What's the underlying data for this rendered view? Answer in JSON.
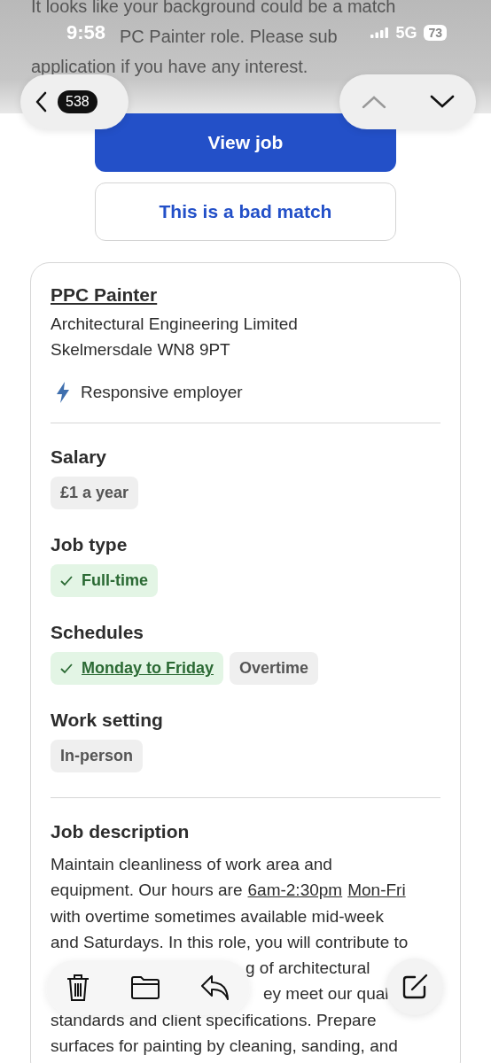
{
  "intro_lines": [
    "It looks like your background could be a match",
    "PC Painter role. Please sub",
    "application if you have any interest."
  ],
  "status_bar": {
    "time": "9:58",
    "network": "5G",
    "battery": "73"
  },
  "nav": {
    "count": "538"
  },
  "buttons": {
    "primary": "View job",
    "secondary": "This is a bad match"
  },
  "job": {
    "title": "PPC Painter",
    "company": "Architectural Engineering Limited",
    "location": "Skelmersdale WN8 9PT",
    "badge": "Responsive employer"
  },
  "sections": [
    {
      "heading": "Salary",
      "tags": [
        {
          "label": "£1 a year",
          "matched": false,
          "link": false
        }
      ]
    },
    {
      "heading": "Job type",
      "tags": [
        {
          "label": "Full-time",
          "matched": true,
          "link": false
        }
      ]
    },
    {
      "heading": "Schedules",
      "tags": [
        {
          "label": "Monday to Friday",
          "matched": true,
          "link": true
        },
        {
          "label": "Overtime",
          "matched": false,
          "link": false
        }
      ]
    },
    {
      "heading": "Work setting",
      "tags": [
        {
          "label": "In-person",
          "matched": false,
          "link": false
        }
      ]
    }
  ],
  "description": {
    "heading": "Job description",
    "lines": [
      [
        {
          "text": "Maintain cleanliness of work area and",
          "link": false
        }
      ],
      [
        {
          "text": "equipment. Our hours are",
          "link": false
        },
        {
          "text": "6am-2:30pm",
          "link": true
        },
        {
          "text": "Mon-Fri",
          "link": true
        }
      ],
      [
        {
          "text": "with overtime sometimes available mid-week",
          "link": false
        }
      ],
      [
        {
          "text": "and Saturdays. In this role, you will contribute to",
          "link": false
        }
      ],
      [
        {
          "text": "g of architectural",
          "link": false
        }
      ],
      [
        {
          "text": "ey meet our qual",
          "link": false
        }
      ],
      [
        {
          "text": "standards and client specifications. Prepare",
          "link": false
        }
      ],
      [
        {
          "text": "surfaces for painting by cleaning, sanding, and",
          "link": false
        }
      ]
    ]
  }
}
